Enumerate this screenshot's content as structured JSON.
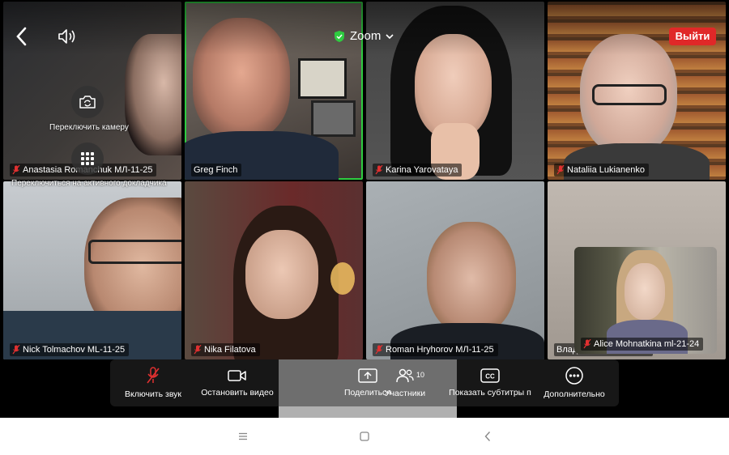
{
  "topbar": {
    "title": "Zoom",
    "leave_label": "Выйти"
  },
  "overlays": {
    "switch_camera_label": "Переключить камеру",
    "active_speaker_label": "Переключиться на активного докладчика"
  },
  "participants": [
    {
      "name": "Anastasia Romanchuk МЛ-11-25",
      "muted": true
    },
    {
      "name": "Greg Finch",
      "muted": false,
      "active": true
    },
    {
      "name": "Karina Yarovataya",
      "muted": true
    },
    {
      "name": "Nataliia Lukianenko",
      "muted": true
    },
    {
      "name": "Nick Tolmachov ML-11-25",
      "muted": true
    },
    {
      "name": "Nika Filatova",
      "muted": true
    },
    {
      "name": "Roman Hryhorov МЛ-11-25",
      "muted": true
    },
    {
      "name": "Владислав Никоненко",
      "muted": false
    }
  ],
  "self_view": {
    "name": "Alice Mohnatkina ml-21-24",
    "muted": true
  },
  "toolbar": {
    "unmute_label": "Включить звук",
    "stop_video_label": "Остановить видео",
    "share_label": "Поделиться",
    "participants_label": "Участники",
    "participants_count": "10",
    "captions_label": "Показать субтитры п",
    "more_label": "Дополнительно"
  },
  "colors": {
    "active_border": "#2ecc40",
    "leave_button": "#e02828",
    "shield_green": "#2ecc40",
    "toolbar_bg": "#191919"
  }
}
